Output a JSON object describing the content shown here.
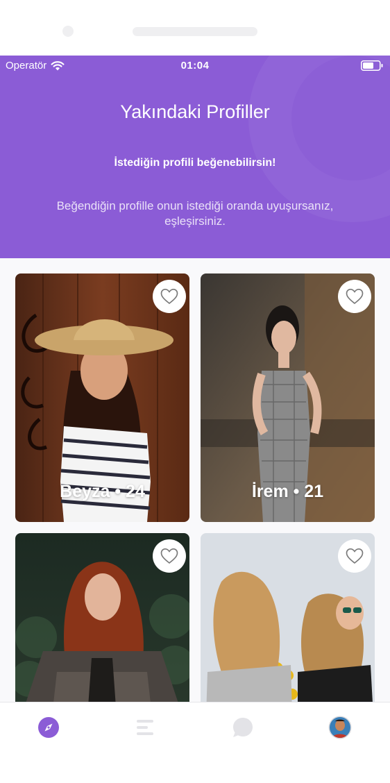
{
  "status_bar": {
    "carrier": "Operatör",
    "time": "01:04",
    "wifi_icon": "wifi-icon",
    "battery_icon": "battery-icon"
  },
  "header": {
    "title": "Yakındaki Profiller",
    "subtitle": "İstediğin profili beğenebilirsin!",
    "description": "Beğendiğin profille onun istediği oranda uyuşursanız, eşleşirsiniz.",
    "background_color": "#8b5cd6"
  },
  "profiles": [
    {
      "label": "Beyza • 24",
      "liked": false,
      "icon": "heart-outline-icon"
    },
    {
      "label": "İrem • 21",
      "liked": false,
      "icon": "heart-outline-icon"
    },
    {
      "label": "",
      "liked": false,
      "icon": "heart-outline-icon"
    },
    {
      "label": "",
      "liked": false,
      "icon": "heart-outline-icon"
    }
  ],
  "tabbar": {
    "active_index": 0,
    "active_color": "#8b5cd6",
    "inactive_color": "#e3e3e7",
    "tabs": [
      {
        "icon": "compass-icon",
        "active": true
      },
      {
        "icon": "list-icon",
        "active": false
      },
      {
        "icon": "chat-bubble-icon",
        "active": false
      },
      {
        "icon": "profile-avatar-icon",
        "active": false
      }
    ]
  }
}
